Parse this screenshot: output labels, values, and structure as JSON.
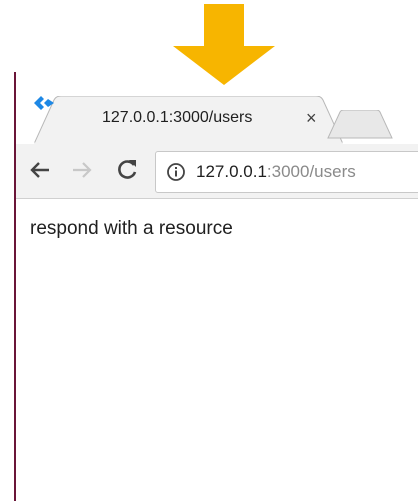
{
  "pointer_arrow": {
    "icon": "down-arrow-icon",
    "color": "#F7B500"
  },
  "tab": {
    "favicon": "express-favicon-icon",
    "title": "127.0.0.1:3000/users",
    "close_label": "×"
  },
  "toolbar": {
    "back_icon": "back-arrow-icon",
    "forward_icon": "forward-arrow-icon",
    "reload_icon": "reload-icon"
  },
  "address_bar": {
    "info_icon": "info-icon",
    "url_host": "127.0.0.1",
    "url_rest": ":3000/users"
  },
  "page": {
    "body_text": "respond with a resource"
  },
  "colors": {
    "accent_arrow": "#F7B500",
    "favicon_blue": "#1E88E5",
    "toolbar_bg": "#f2f2f2",
    "window_border": "#6a1538"
  }
}
